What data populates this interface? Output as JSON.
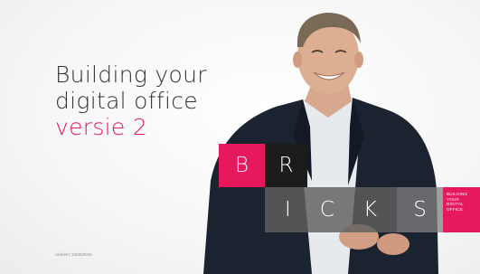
{
  "slide": {
    "title_line1": "Building your",
    "title_line2": "digital office",
    "title_accent": "versie 2",
    "date": "Arnhem: 24/05/2016"
  },
  "logo": {
    "letter_b": "B",
    "letter_r": "R",
    "letter_i": "I",
    "letter_c": "C",
    "letter_k": "K",
    "letter_s": "S",
    "tagline": [
      "BUILDING",
      "YOUR",
      "DIGITAL",
      "OFFICE"
    ]
  },
  "colors": {
    "accent": "#e6195c",
    "dark_tile": "#1c1c1c",
    "grey_tile": "#5f5f5f",
    "text": "#333333"
  }
}
